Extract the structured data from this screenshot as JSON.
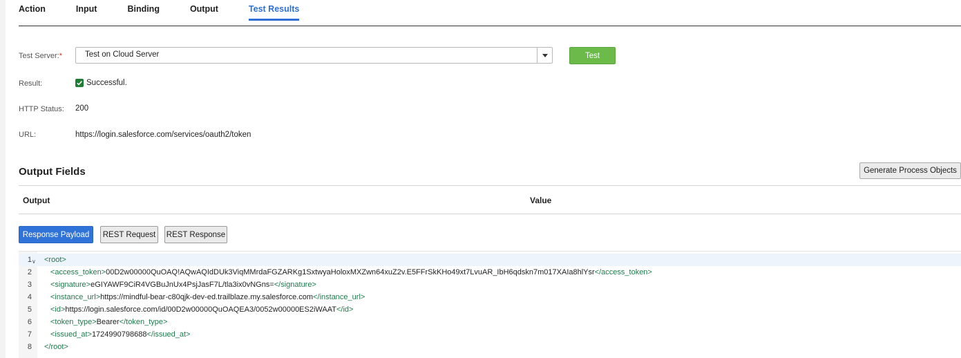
{
  "tabs": [
    {
      "label": "Action",
      "active": false
    },
    {
      "label": "Input",
      "active": false
    },
    {
      "label": "Binding",
      "active": false
    },
    {
      "label": "Output",
      "active": false
    },
    {
      "label": "Test Results",
      "active": true
    }
  ],
  "test_server": {
    "label": "Test Server:",
    "required_mark": "*",
    "selected": "Test on Cloud Server",
    "test_button": "Test"
  },
  "result": {
    "label": "Result:",
    "value": "Successful."
  },
  "http_status": {
    "label": "HTTP Status:",
    "value": "200"
  },
  "url": {
    "label": "URL:",
    "value": "https://login.salesforce.com/services/oauth2/token"
  },
  "output_fields": {
    "title": "Output Fields",
    "generate_button": "Generate Process Objects",
    "columns": [
      "Output",
      "Value"
    ]
  },
  "payload_tabs": [
    {
      "label": "Response Payload",
      "active": true
    },
    {
      "label": "REST Request",
      "active": false
    },
    {
      "label": "REST Response",
      "active": false
    }
  ],
  "code_lines": [
    {
      "num": "1",
      "open": "<root>",
      "text": "",
      "close": ""
    },
    {
      "num": "2",
      "open": "<access_token>",
      "text": "00D2w00000QuOAQ!AQwAQIdDUk3ViqMMrdaFGZARKg1SxtwyaHoloxMXZwn64xuZ2v.E5FFrSkKHo49xt7LvuAR_IbH6qdskn7m017XAIa8hlYsr",
      "close": "</access_token>"
    },
    {
      "num": "3",
      "open": "<signature>",
      "text": "eGIYAWF9CiR4VGBuJnUx4PsjJasF7L/tla3ix0vNGns=",
      "close": "</signature>"
    },
    {
      "num": "4",
      "open": "<instance_url>",
      "text": "https://mindful-bear-c80qjk-dev-ed.trailblaze.my.salesforce.com",
      "close": "</instance_url>"
    },
    {
      "num": "5",
      "open": "<id>",
      "text": "https://login.salesforce.com/id/00D2w00000QuOAQEA3/0052w00000ES2iWAAT",
      "close": "</id>"
    },
    {
      "num": "6",
      "open": "<token_type>",
      "text": "Bearer",
      "close": "</token_type>"
    },
    {
      "num": "7",
      "open": "<issued_at>",
      "text": "1724990798688",
      "close": "</issued_at>"
    },
    {
      "num": "8",
      "open": "</root>",
      "text": "",
      "close": ""
    }
  ],
  "colors": {
    "accent": "#2f6fd6",
    "test_button": "#6cbb4a",
    "success_check": "#1e7d33",
    "xml_tag": "#1f7a4d"
  },
  "icons": {
    "dropdown": "chevron-down-icon",
    "result": "checkbox-checked-icon",
    "fold": "fold-chevron-icon"
  }
}
